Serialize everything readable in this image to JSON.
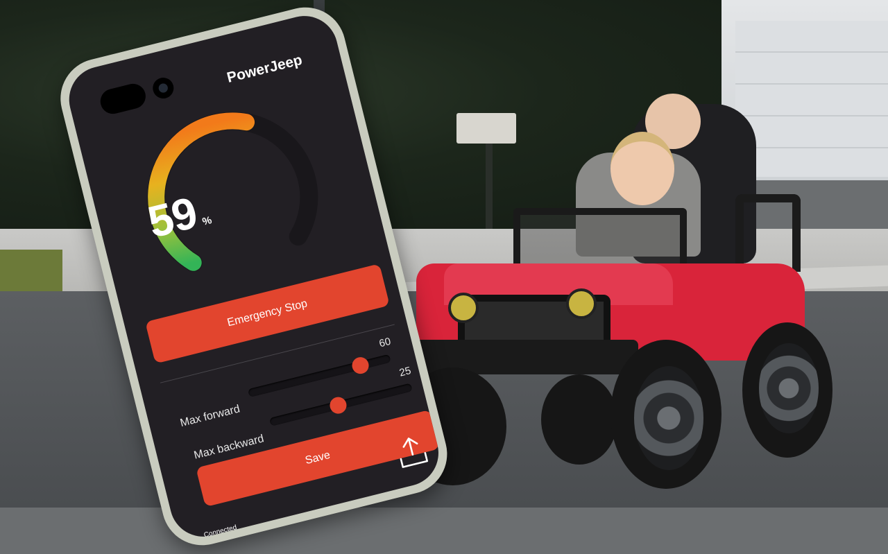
{
  "app": {
    "title": "PowerJeep"
  },
  "gauge": {
    "value": "59",
    "unit": "%",
    "level": 0.59
  },
  "buttons": {
    "emergency_stop": "Emergency Stop",
    "save": "Save"
  },
  "sliders": [
    {
      "label": "Max forward",
      "value": "60",
      "level": 0.6
    },
    {
      "label": "Max backward",
      "value": "25",
      "level": 0.25
    }
  ],
  "status": {
    "text": "Connected"
  },
  "icons": {
    "share": "share-icon"
  },
  "colors": {
    "accent": "#e2452e",
    "screen_bg": "#221f24",
    "gauge_start": "#f5a623",
    "gauge_end": "#4caf50"
  }
}
